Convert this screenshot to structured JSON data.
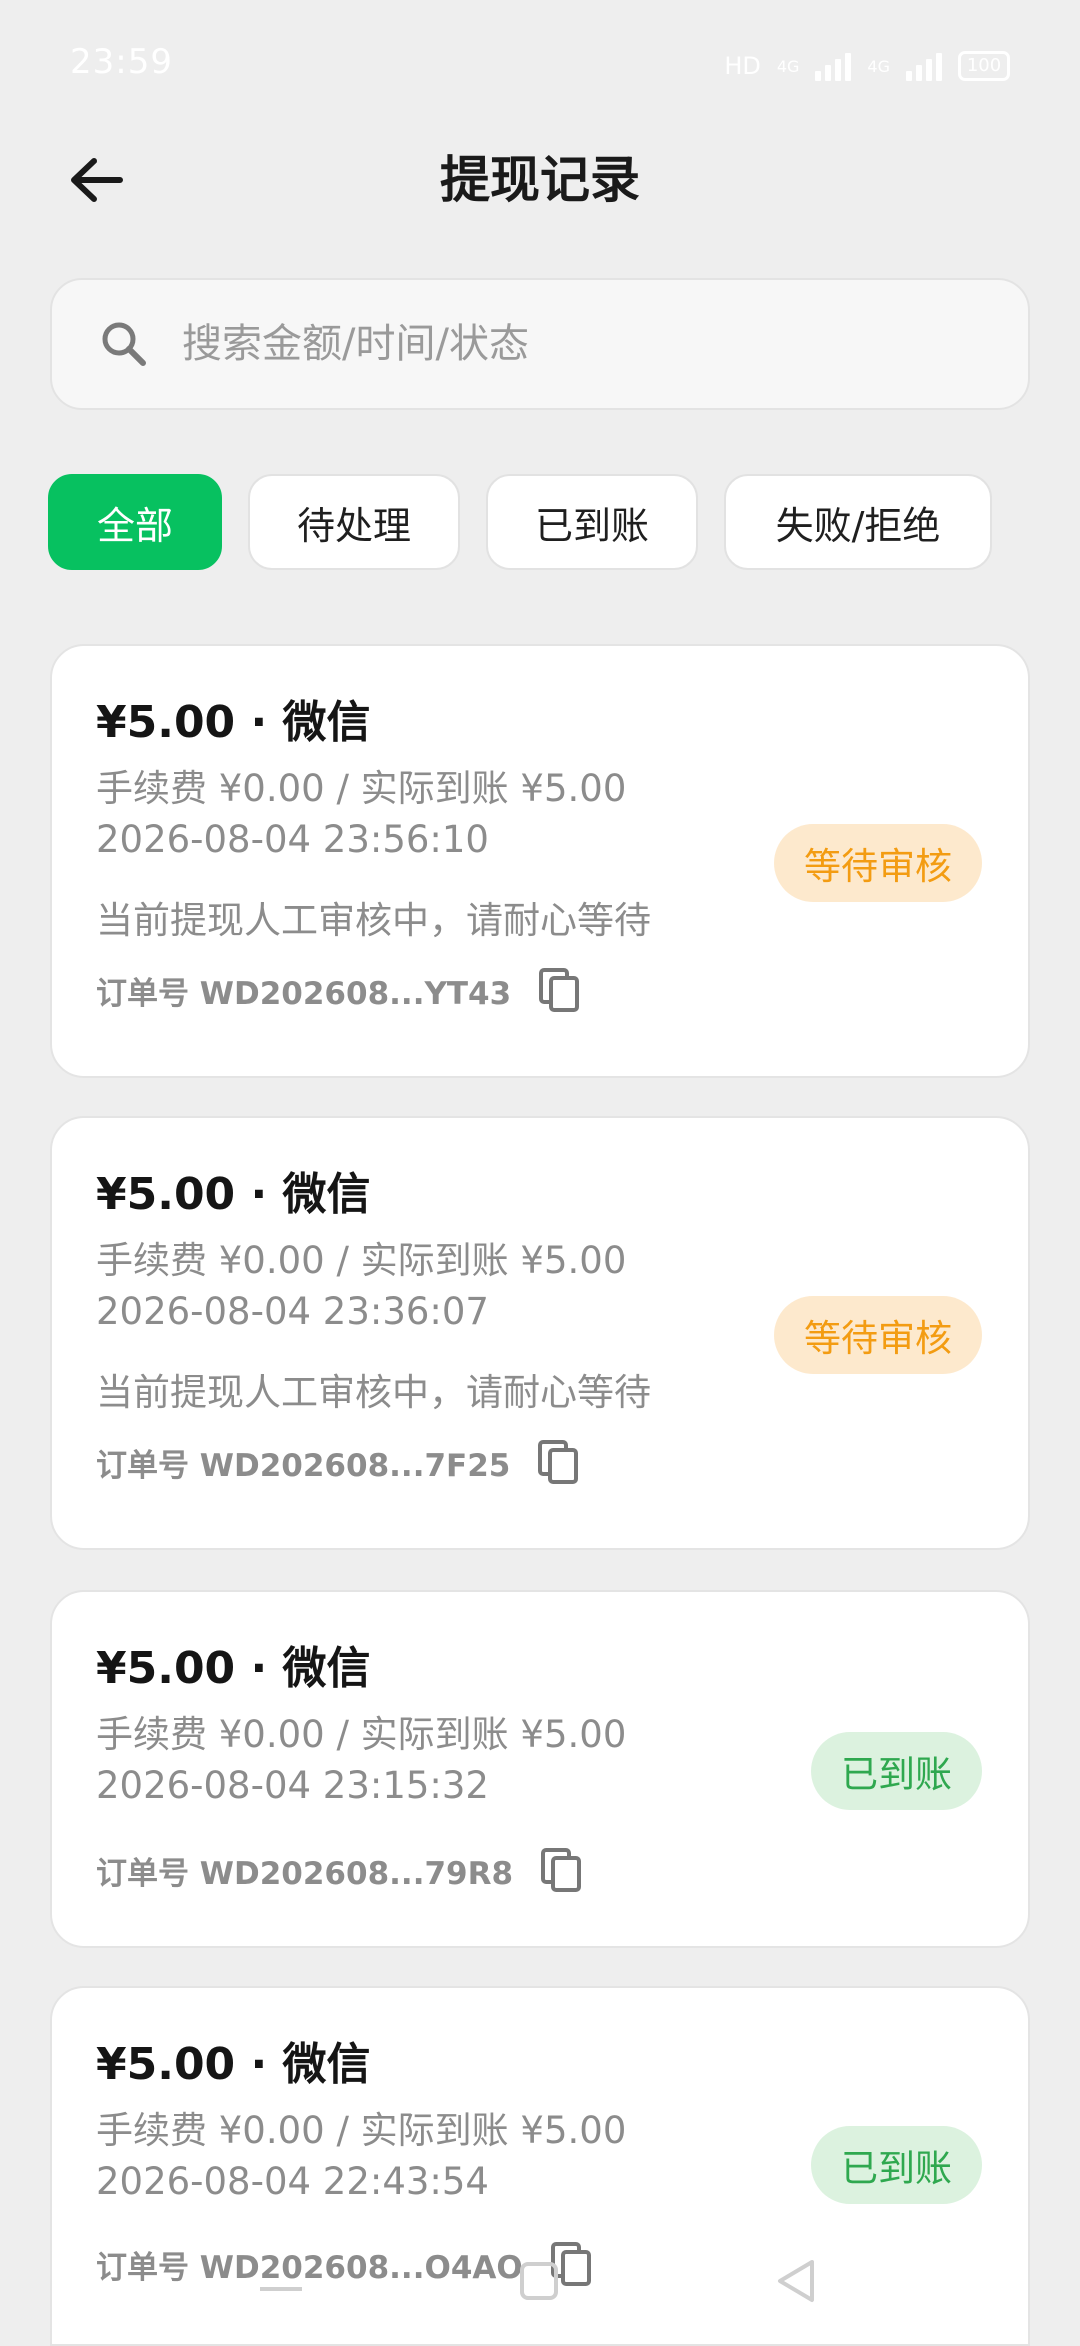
{
  "status_bar": {
    "time": "23:59",
    "hd_label": "HD",
    "network_1": "4G",
    "network_2": "4G",
    "battery": "100"
  },
  "header": {
    "title": "提现记录"
  },
  "search": {
    "placeholder": "搜索金额/时间/状态"
  },
  "filters": [
    {
      "label": "全部",
      "active": true
    },
    {
      "label": "待处理",
      "active": false
    },
    {
      "label": "已到账",
      "active": false
    },
    {
      "label": "失败/拒绝",
      "active": false
    }
  ],
  "records": [
    {
      "amount": "¥5.00 · 微信",
      "fee": "手续费 ¥0.00 / 实际到账 ¥5.00",
      "time": "2026-08-04 23:56:10",
      "note": "当前提现人工审核中，请耐心等待",
      "order": "订单号 WD202608...YT43",
      "status": "等待审核",
      "status_type": "pending"
    },
    {
      "amount": "¥5.00 · 微信",
      "fee": "手续费 ¥0.00 / 实际到账 ¥5.00",
      "time": "2026-08-04 23:36:07",
      "note": "当前提现人工审核中，请耐心等待",
      "order": "订单号 WD202608...7F25",
      "status": "等待审核",
      "status_type": "pending"
    },
    {
      "amount": "¥5.00 · 微信",
      "fee": "手续费 ¥0.00 / 实际到账 ¥5.00",
      "time": "2026-08-04 23:15:32",
      "order": "订单号 WD202608...79R8",
      "status": "已到账",
      "status_type": "done"
    },
    {
      "amount": "¥5.00 · 微信",
      "fee": "手续费 ¥0.00 / 实际到账 ¥5.00",
      "time": "2026-08-04 22:43:54",
      "order": "订单号 WD202608...O4AO",
      "status": "已到账",
      "status_type": "done"
    }
  ],
  "colors": {
    "accent": "#07c160",
    "pending_bg": "#fde9cd",
    "pending_text": "#f39c12",
    "done_bg": "#dcf2df",
    "done_text": "#2fa84f"
  },
  "icons": {
    "back": "arrow-left-icon",
    "search": "search-icon",
    "copy": "copy-icon"
  }
}
